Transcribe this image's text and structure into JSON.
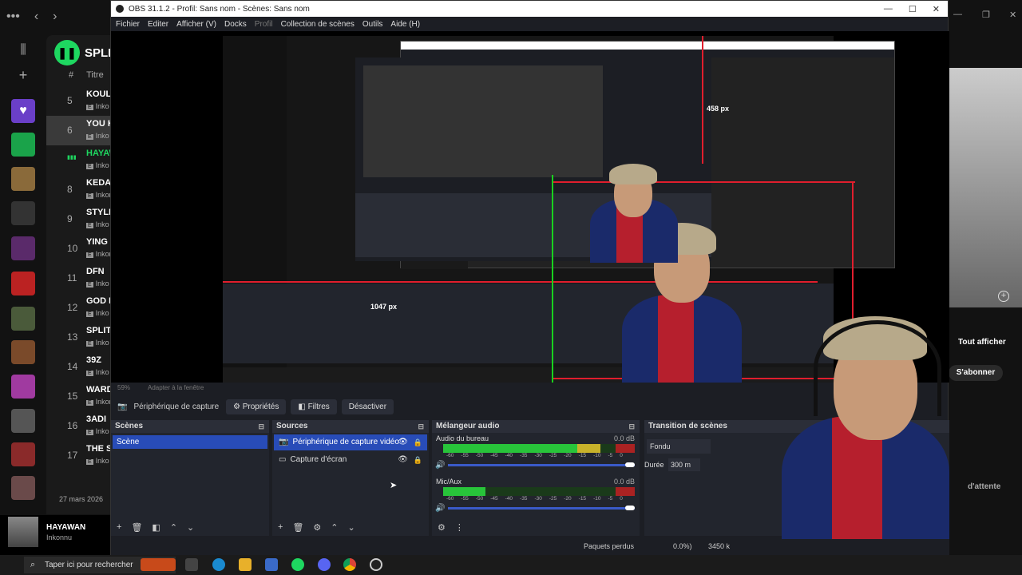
{
  "obs": {
    "title": "OBS 31.1.2 - Profil: Sans nom - Scènes: Sans nom",
    "window_controls": [
      "—",
      "☐",
      "✕"
    ],
    "menu": [
      "Fichier",
      "Editer",
      "Afficher (V)",
      "Docks",
      "Profil",
      "Collection de scènes",
      "Outils",
      "Aide (H)"
    ],
    "menu_disabled": "Profil",
    "preview": {
      "measure_top": "458 px",
      "measure_left": "1047 px"
    },
    "zoom": {
      "percent": "59%",
      "fit": "Adapter à la fenêtre"
    },
    "source_bar": {
      "source_label": "Périphérique de capture vic",
      "properties": "Propriétés",
      "filters": "Filtres",
      "deactivate": "Désactiver"
    },
    "scenes": {
      "header": "Scènes",
      "items": [
        "Scène"
      ]
    },
    "sources": {
      "header": "Sources",
      "items": [
        {
          "label": "Périphérique de capture vidéo",
          "selected": true
        },
        {
          "label": "Capture d'écran",
          "selected": false
        }
      ]
    },
    "mixer": {
      "header": "Mélangeur audio",
      "channels": [
        {
          "name": "Audio du bureau",
          "db": "0.0 dB",
          "level": 0.82
        },
        {
          "name": "Mic/Aux",
          "db": "0.0 dB",
          "level": 0.22
        }
      ],
      "scale": [
        "-60",
        "-55",
        "-50",
        "-45",
        "-40",
        "-35",
        "-30",
        "-25",
        "-20",
        "-15",
        "-10",
        "-5",
        "0"
      ]
    },
    "transitions": {
      "header": "Transition de scènes",
      "selected": "Fondu",
      "duration_label": "Durée",
      "duration_value": "300 m"
    },
    "status": {
      "dropped": "Paquets perdus",
      "percent": "0.0%)",
      "kbps": "3450 k"
    }
  },
  "spotify": {
    "brand": "SPLI",
    "col_num": "#",
    "col_title": "Titre",
    "rows": [
      {
        "num": "5",
        "title": "KOULO",
        "artist": "Inko"
      },
      {
        "num": "6",
        "title": "YOU K",
        "artist": "Inko",
        "selected": true
      },
      {
        "num": "",
        "title": "HAYAW",
        "artist": "Inko",
        "playing": true
      },
      {
        "num": "8",
        "title": "KEDA",
        "artist": "Inkonnu"
      },
      {
        "num": "9",
        "title": "STYLE",
        "artist": "Inko"
      },
      {
        "num": "10",
        "title": "YING Y",
        "artist": "Inkonn"
      },
      {
        "num": "11",
        "title": "DFN",
        "artist": "Inko"
      },
      {
        "num": "12",
        "title": "GOD D",
        "artist": "Inko"
      },
      {
        "num": "13",
        "title": "SPLIT",
        "artist": "Inko"
      },
      {
        "num": "14",
        "title": "39Z",
        "artist": "Inko"
      },
      {
        "num": "15",
        "title": "WARD",
        "artist": "Inkonn"
      },
      {
        "num": "16",
        "title": "3ADI",
        "artist": "Inko"
      },
      {
        "num": "17",
        "title": "THE SA",
        "artist": "Inko"
      }
    ],
    "date": "27 mars 2026",
    "now_playing_title": "HAYAWAN",
    "now_playing_artist": "Inkonnu"
  },
  "right_panel": {
    "show_all": "Tout afficher",
    "subscribe": "S'abonner",
    "waiting": "d'attente"
  },
  "taskbar": {
    "search_placeholder": "Taper ici pour rechercher"
  },
  "colors": {
    "accent": "#284cb8",
    "spotify_green": "#1ed760",
    "guide_red": "#e01e2d",
    "guide_green": "#19d11f"
  }
}
